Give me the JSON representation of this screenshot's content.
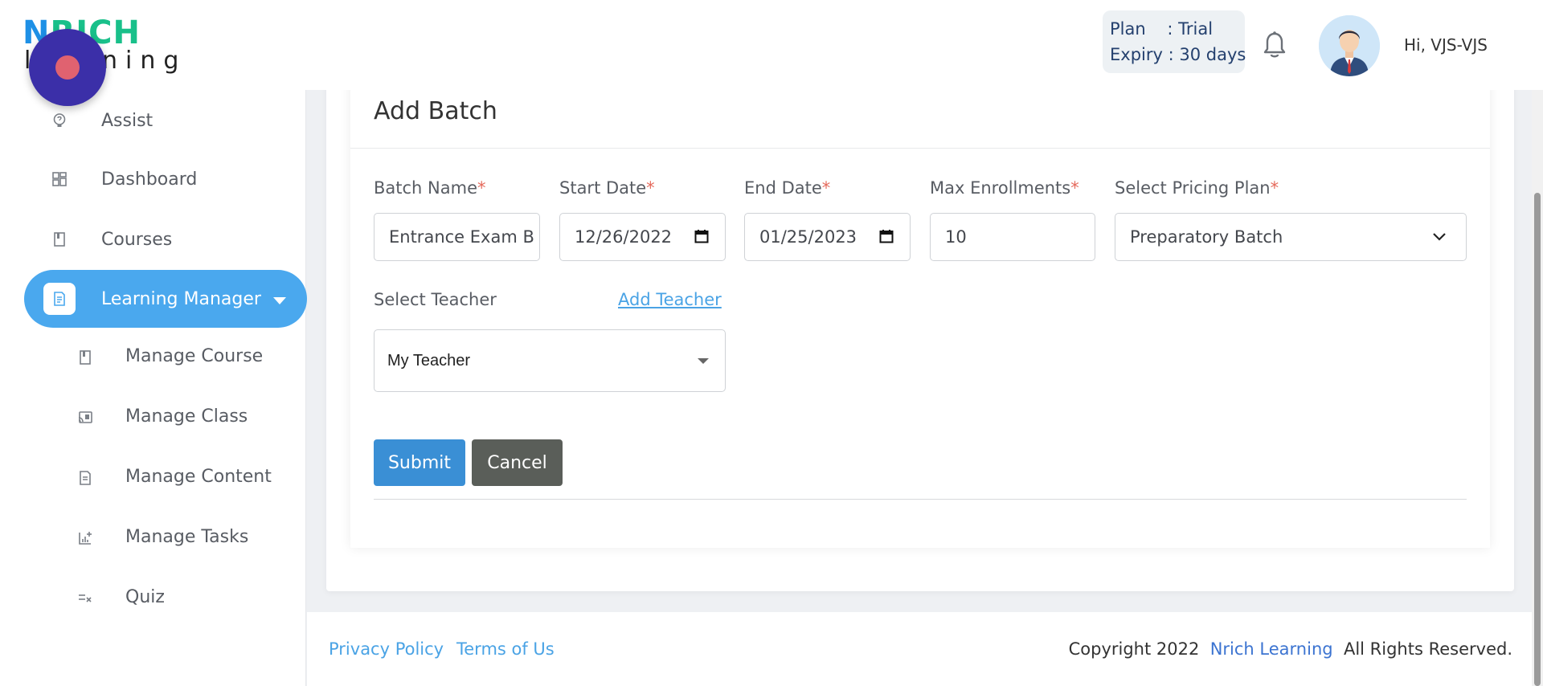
{
  "logo": {
    "top_part1": "N",
    "top_part2": "RICH",
    "bottom": "learning"
  },
  "header": {
    "plan_line": "Plan    : Trial",
    "expiry_line": "Expiry : 30 days",
    "greeting": "Hi, VJS-VJS"
  },
  "sidebar": {
    "items": [
      {
        "label": "Assist",
        "icon": "help-bulb-icon"
      },
      {
        "label": "Dashboard",
        "icon": "dashboard-grid-icon"
      },
      {
        "label": "Courses",
        "icon": "book-icon"
      },
      {
        "label": "Learning Manager",
        "icon": "document-icon",
        "active": true
      }
    ],
    "sub_items": [
      {
        "label": "Manage Course",
        "icon": "book-icon"
      },
      {
        "label": "Manage Class",
        "icon": "cast-icon"
      },
      {
        "label": "Manage Content",
        "icon": "document-icon"
      },
      {
        "label": "Manage Tasks",
        "icon": "chart-add-icon"
      },
      {
        "label": "Quiz",
        "icon": "list-check-icon"
      }
    ]
  },
  "form": {
    "title": "Add Batch",
    "required_mark": "*",
    "batch_name": {
      "label": "Batch Name",
      "value": "Entrance Exam B"
    },
    "start_date": {
      "label": "Start Date",
      "value": "12/26/2022"
    },
    "end_date": {
      "label": "End Date",
      "value": "01/25/2023"
    },
    "max_enrollments": {
      "label": "Max Enrollments",
      "value": "10"
    },
    "pricing_plan": {
      "label": "Select Pricing Plan",
      "value": "Preparatory Batch"
    },
    "teacher": {
      "label": "Select Teacher",
      "add_link": "Add Teacher",
      "value": "My Teacher"
    },
    "submit_label": "Submit",
    "cancel_label": "Cancel"
  },
  "footer": {
    "privacy": "Privacy Policy",
    "terms": "Terms of Us",
    "copyright_prefix": "Copyright 2022",
    "brand": "Nrich Learning",
    "copyright_suffix": "All Rights Reserved."
  },
  "colors": {
    "accent": "#4aa8ee",
    "submit": "#3a8fd5",
    "cancel": "#5a5e59",
    "fab": "#3b2fa8",
    "required": "#e56a5c"
  }
}
